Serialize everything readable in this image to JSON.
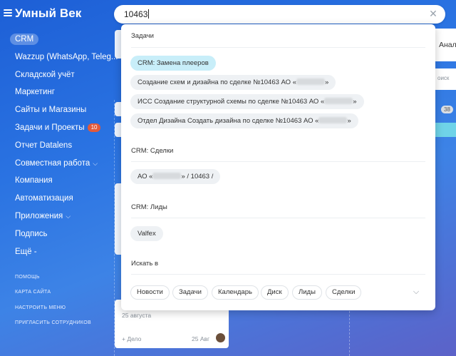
{
  "header": {
    "brand": "Умный Век",
    "search_value": "10463"
  },
  "sidebar": {
    "items": [
      {
        "label": "CRM"
      },
      {
        "label": "Wazzup (WhatsApp, Teleg..."
      },
      {
        "label": "Складской учёт"
      },
      {
        "label": "Маркетинг"
      },
      {
        "label": "Сайты и Магазины"
      },
      {
        "label": "Задачи и Проекты",
        "badge": "10"
      },
      {
        "label": "Отчет Datalens"
      },
      {
        "label": "Совместная работа"
      },
      {
        "label": "Компания"
      },
      {
        "label": "Автоматизация"
      },
      {
        "label": "Приложения"
      },
      {
        "label": "Подпись"
      },
      {
        "label": "Ещё -"
      }
    ],
    "footer_links": [
      "ПОМОЩЬ",
      "КАРТА САЙТА",
      "НАСТРОИТЬ МЕНЮ",
      "ПРИГЛАСИТЬ СОТРУДНИКОВ"
    ]
  },
  "background": {
    "right_tab": "Анал",
    "search_hint": "оиск",
    "count_badge": "38",
    "card_date": "25 августа",
    "add_deal": "+ Дело",
    "deal_date": "25 Авг"
  },
  "dropdown": {
    "tasks_title": "Задачи",
    "tasks": [
      {
        "text": "CRM: Замена плееров"
      },
      {
        "prefix": "Создание схем и дизайна по сделке №10463 АО «",
        "suffix": "»"
      },
      {
        "prefix": "ИСС Создание структурной схемы по сделке №10463 АО «",
        "suffix": "»"
      },
      {
        "prefix": "Отдел Дизайна Создать дизайна по сделке №10463 АО «",
        "suffix": "»"
      }
    ],
    "deals_title": "CRM: Сделки",
    "deals": [
      {
        "prefix": "АО «",
        "suffix": "» / 10463 /"
      }
    ],
    "leads_title": "CRM: Лиды",
    "leads": [
      "Valfex"
    ],
    "search_in_title": "Искать в",
    "filters": [
      "Новости",
      "Задачи",
      "Календарь",
      "Диск",
      "Лиды",
      "Сделки"
    ]
  }
}
